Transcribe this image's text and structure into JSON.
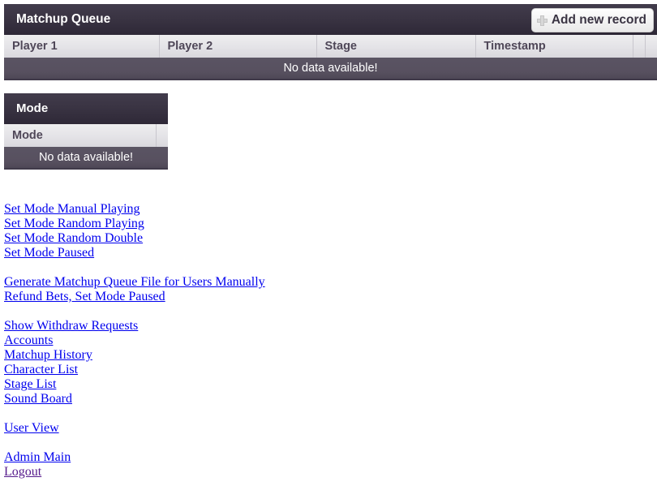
{
  "matchup_queue": {
    "title": "Matchup Queue",
    "add_button_label": "Add new record",
    "add_button_icon": "plus-icon",
    "columns": [
      "Player 1",
      "Player 2",
      "Stage",
      "Timestamp",
      "",
      ""
    ],
    "empty_message": "No data available!",
    "rows": []
  },
  "mode_table": {
    "title": "Mode",
    "columns": [
      "Mode",
      ""
    ],
    "empty_message": "No data available!",
    "rows": []
  },
  "links": {
    "mode_actions": [
      {
        "label": "Set Mode Manual Playing",
        "visited": false
      },
      {
        "label": "Set Mode Random Playing",
        "visited": false
      },
      {
        "label": "Set Mode Random Double",
        "visited": false
      },
      {
        "label": "Set Mode Paused",
        "visited": false
      }
    ],
    "file_actions": [
      {
        "label": "Generate Matchup Queue File for Users Manually",
        "visited": false
      },
      {
        "label": "Refund Bets, Set Mode Paused",
        "visited": false
      }
    ],
    "admin_pages": [
      {
        "label": "Show Withdraw Requests",
        "visited": false
      },
      {
        "label": "Accounts",
        "visited": false
      },
      {
        "label": "Matchup History",
        "visited": false
      },
      {
        "label": "Character List",
        "visited": false
      },
      {
        "label": "Stage List",
        "visited": false
      },
      {
        "label": "Sound Board",
        "visited": false
      }
    ],
    "view_links": [
      {
        "label": "User View",
        "visited": false
      }
    ],
    "session_links": [
      {
        "label": "Admin Main",
        "visited": false
      },
      {
        "label": "Logout",
        "visited": true
      }
    ]
  },
  "colors": {
    "title_bar_dark": "#3a3443",
    "header_row_light": "#e4e3e7",
    "empty_row_gray": "#57505f",
    "link_blue": "#0000ee",
    "link_visited_purple": "#551a8b"
  }
}
